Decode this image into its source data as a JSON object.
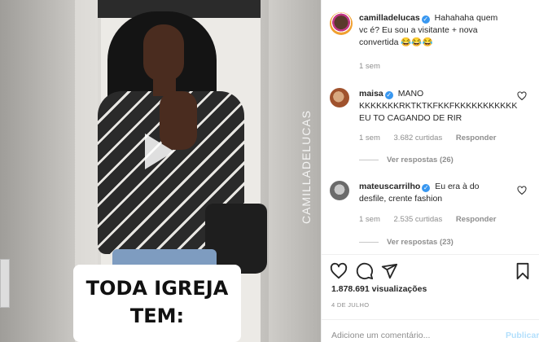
{
  "post": {
    "author": "camilladelucas",
    "caption": "Hahahaha quem vc é? Eu sou a visitante + nova convertida 😂😂😂",
    "time": "1 sem"
  },
  "video": {
    "watermark": "CAMILLADELUCAS",
    "overlay_line1": "TODA IGREJA",
    "overlay_line2": "TEM:"
  },
  "comments": [
    {
      "user": "maisa",
      "text": "MANO KKKKKKKRKTKTKFKKFKKKKKKKKKKK EU TO CAGANDO DE RIR",
      "time": "1 sem",
      "likes": "3.682 curtidas",
      "reply": "Responder",
      "view_replies": "Ver respostas (26)"
    },
    {
      "user": "mateuscarrilho",
      "text": "Eu era à do desfile, crente fashion",
      "time": "1 sem",
      "likes": "2.535 curtidas",
      "reply": "Responder",
      "view_replies": "Ver respostas (23)"
    }
  ],
  "stats": {
    "views": "1.878.691 visualizações",
    "date": "4 DE JULHO"
  },
  "composer": {
    "placeholder": "Adicione um comentário...",
    "publish": "Publicar"
  },
  "icons": [
    "heart-icon",
    "comment-icon",
    "share-icon",
    "bookmark-icon",
    "play-icon",
    "verified-badge-icon"
  ],
  "colors": {
    "verified": "#3897f0",
    "publish_disabled": "#b2dffc",
    "muted": "#8e8e8e"
  }
}
